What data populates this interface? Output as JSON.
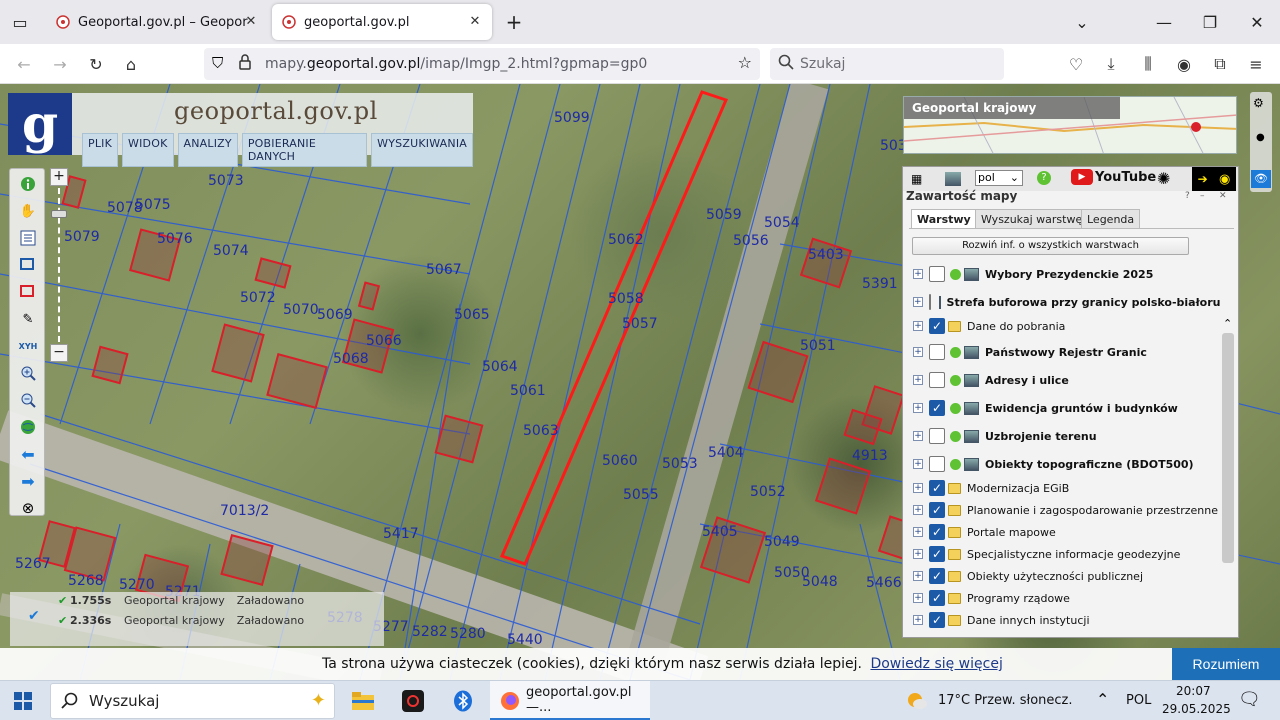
{
  "browser": {
    "tabs": [
      {
        "title": "Geoportal.gov.pl – Geoportal Inf",
        "active": false
      },
      {
        "title": "geoportal.gov.pl",
        "active": true
      }
    ],
    "url_prefix": "mapy.",
    "url_domain": "geoportal.gov.pl",
    "url_path": "/imap/Imgp_2.html?gpmap=gp0",
    "search_placeholder": "Szukaj"
  },
  "header": {
    "logo_letter": "g",
    "site_title": "geoportal.gov.pl",
    "menu": [
      "PLIK",
      "WIDOK",
      "ANALIZY",
      "POBIERANIE DANYCH",
      "WYSZUKIWANIA"
    ]
  },
  "overview": {
    "title": "Geoportal krajowy"
  },
  "contents_panel": {
    "title": "Zawartość mapy",
    "language": "pol",
    "youtube_label": "YouTube",
    "tabs": [
      "Warstwy",
      "Wyszukaj warstwę",
      "Legenda"
    ],
    "expand_all": "Rozwiń inf. o wszystkich warstwach",
    "layers": [
      {
        "label": "Wybory Prezydenckie 2025",
        "checked": false,
        "type": "wms",
        "bold": true
      },
      {
        "label": "Strefa buforowa przy granicy polsko-białoruskiej",
        "checked": false,
        "type": "wms",
        "bold": true
      },
      {
        "label": "Dane do pobrania",
        "checked": true,
        "type": "folder",
        "bold": false
      },
      {
        "label": "Państwowy Rejestr Granic",
        "checked": false,
        "type": "wms",
        "bold": true
      },
      {
        "label": "Adresy i ulice",
        "checked": false,
        "type": "wms",
        "bold": true
      },
      {
        "label": "Ewidencja gruntów i budynków",
        "checked": true,
        "type": "wms",
        "bold": true
      },
      {
        "label": "Uzbrojenie terenu",
        "checked": false,
        "type": "wms",
        "bold": true
      },
      {
        "label": "Obiekty topograficzne (BDOT500)",
        "checked": false,
        "type": "wms",
        "bold": true
      },
      {
        "label": "Modernizacja EGiB",
        "checked": true,
        "type": "folder",
        "bold": false
      },
      {
        "label": "Planowanie i zagospodarowanie przestrzenne",
        "checked": true,
        "type": "folder",
        "bold": false
      },
      {
        "label": "Portale mapowe",
        "checked": true,
        "type": "folder",
        "bold": false
      },
      {
        "label": "Specjalistyczne informacje geodezyjne",
        "checked": true,
        "type": "folder",
        "bold": false
      },
      {
        "label": "Obiekty użyteczności publicznej",
        "checked": true,
        "type": "folder",
        "bold": false
      },
      {
        "label": "Programy rządowe",
        "checked": true,
        "type": "folder",
        "bold": false
      },
      {
        "label": "Dane innych instytucji",
        "checked": true,
        "type": "folder",
        "bold": false
      }
    ]
  },
  "parcels": [
    {
      "n": "5099"
    },
    {
      "n": "5073"
    },
    {
      "n": "5078"
    },
    {
      "n": "5075"
    },
    {
      "n": "5079"
    },
    {
      "n": "5076"
    },
    {
      "n": "5074"
    },
    {
      "n": "5072"
    },
    {
      "n": "5070"
    },
    {
      "n": "5069"
    },
    {
      "n": "5067"
    },
    {
      "n": "5065"
    },
    {
      "n": "5066"
    },
    {
      "n": "5068"
    },
    {
      "n": "5064"
    },
    {
      "n": "5061"
    },
    {
      "n": "5063"
    },
    {
      "n": "5062"
    },
    {
      "n": "5058"
    },
    {
      "n": "5057"
    },
    {
      "n": "5059"
    },
    {
      "n": "5056"
    },
    {
      "n": "5054"
    },
    {
      "n": "5060"
    },
    {
      "n": "5053"
    },
    {
      "n": "5055"
    },
    {
      "n": "5404"
    },
    {
      "n": "5052"
    },
    {
      "n": "5405"
    },
    {
      "n": "5049"
    },
    {
      "n": "5050"
    },
    {
      "n": "5048"
    },
    {
      "n": "5051"
    },
    {
      "n": "5403"
    },
    {
      "n": "5391"
    },
    {
      "n": "4913"
    },
    {
      "n": "5466"
    },
    {
      "n": "7013/2"
    },
    {
      "n": "5417"
    },
    {
      "n": "5267"
    },
    {
      "n": "5268"
    },
    {
      "n": "5270"
    },
    {
      "n": "5271"
    },
    {
      "n": "5278"
    },
    {
      "n": "5277"
    },
    {
      "n": "5282"
    },
    {
      "n": "5280"
    },
    {
      "n": "5440"
    },
    {
      "n": "503"
    }
  ],
  "load_status": [
    {
      "time": "1.755s",
      "source": "Geoportal krajowy",
      "state": "Załadowano"
    },
    {
      "time": "2.336s",
      "source": "Geoportal krajowy",
      "state": "Załadowano"
    }
  ],
  "cookie": {
    "text": "Ta strona używa ciasteczek (cookies), dzięki którym nasz serwis działa lepiej.",
    "link": "Dowiedz się więcej",
    "button": "Rozumiem"
  },
  "taskbar": {
    "search": "Wyszukaj",
    "app_label": "geoportal.gov.pl —...",
    "weather": "17°C  Przew. słonecz.",
    "lang": "POL",
    "time": "20:07",
    "date": "29.05.2025"
  },
  "colors": {
    "parcel_line": "#2a5bd7",
    "parcel_label": "#1e2aa6",
    "building": "#d81f2a",
    "highlight": "#ff1a1a",
    "accent": "#1d6fb8"
  }
}
